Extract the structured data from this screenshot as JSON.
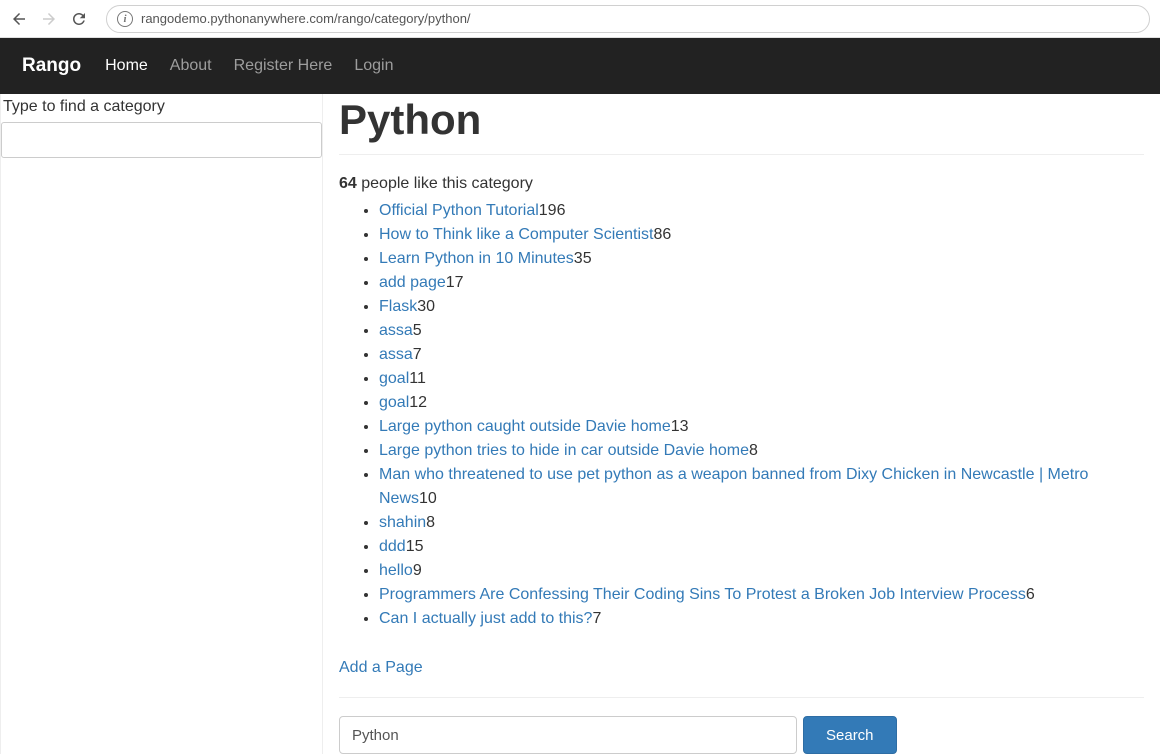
{
  "browser": {
    "url": "rangodemo.pythonanywhere.com/rango/category/python/"
  },
  "navbar": {
    "brand": "Rango",
    "links": [
      {
        "label": "Home",
        "active": true
      },
      {
        "label": "About",
        "active": false
      },
      {
        "label": "Register Here",
        "active": false
      },
      {
        "label": "Login",
        "active": false
      }
    ]
  },
  "sidebar": {
    "search_label": "Type to find a category"
  },
  "category": {
    "title": "Python",
    "likes_count": "64",
    "likes_text": "people like this category",
    "add_page_label": "Add a Page",
    "search_value": "Python",
    "search_button_label": "Search",
    "pages": [
      {
        "title": "Official Python Tutorial",
        "count": "196"
      },
      {
        "title": "How to Think like a Computer Scientist",
        "count": "86"
      },
      {
        "title": "Learn Python in 10 Minutes",
        "count": "35"
      },
      {
        "title": "add page",
        "count": "17"
      },
      {
        "title": "Flask",
        "count": "30"
      },
      {
        "title": "assa",
        "count": "5"
      },
      {
        "title": "assa",
        "count": "7"
      },
      {
        "title": "goal",
        "count": "11"
      },
      {
        "title": "goal",
        "count": "12"
      },
      {
        "title": "Large python caught outside Davie home",
        "count": "13"
      },
      {
        "title": "Large python tries to hide in car outside Davie home",
        "count": "8"
      },
      {
        "title": "Man who threatened to use pet python as a weapon banned from Dixy Chicken in Newcastle | Metro News",
        "count": "10"
      },
      {
        "title": "shahin",
        "count": "8"
      },
      {
        "title": "ddd",
        "count": "15"
      },
      {
        "title": "hello",
        "count": "9"
      },
      {
        "title": "Programmers Are Confessing Their Coding Sins To Protest a Broken Job Interview Process",
        "count": "6"
      },
      {
        "title": "Can I actually just add to this?",
        "count": "7"
      }
    ]
  }
}
